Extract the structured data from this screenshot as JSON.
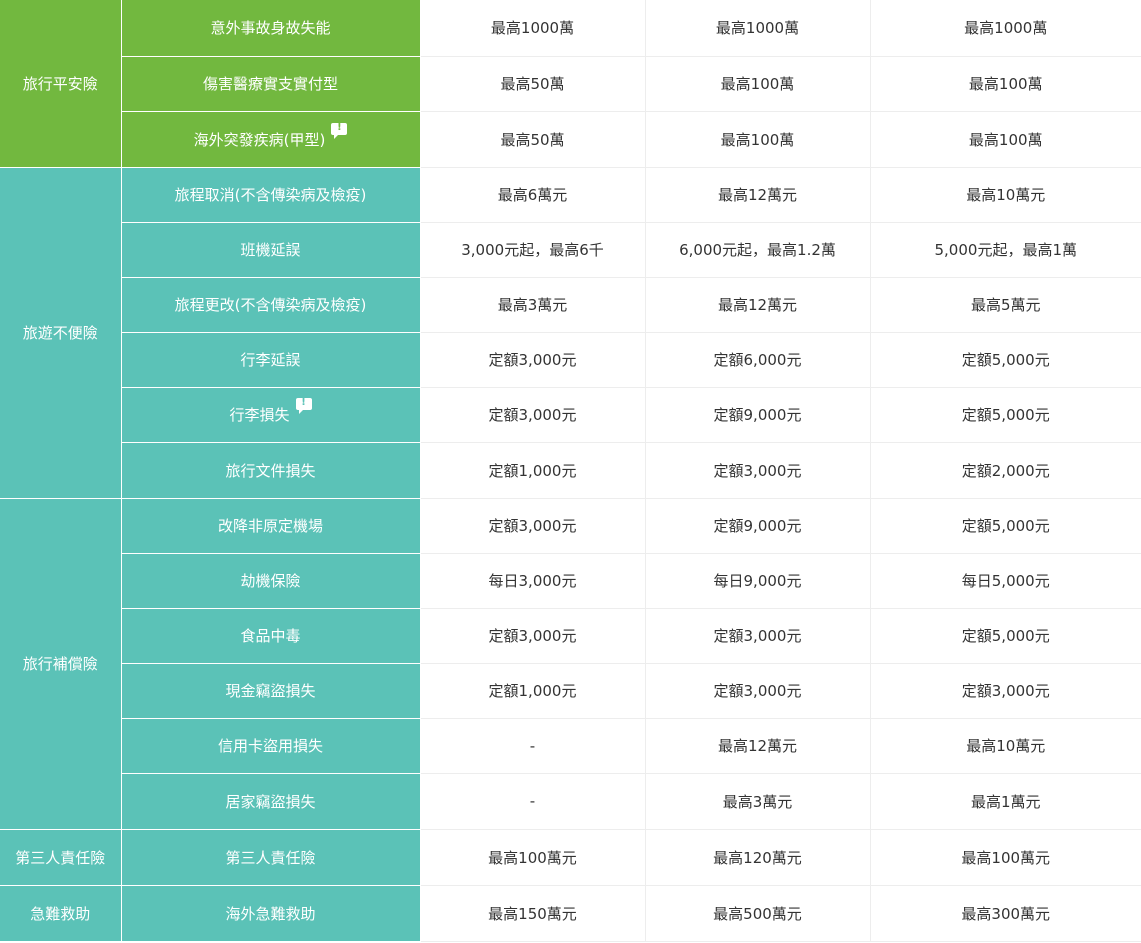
{
  "rows": [
    {
      "category": "旅行平安險",
      "item": "意外事故身故失能",
      "note": false,
      "values": [
        "最高1000萬",
        "最高1000萬",
        "最高1000萬"
      ]
    },
    {
      "item": "傷害醫療實支實付型",
      "note": false,
      "values": [
        "最高50萬",
        "最高100萬",
        "最高100萬"
      ]
    },
    {
      "item": "海外突發疾病(甲型)",
      "note": true,
      "values": [
        "最高50萬",
        "最高100萬",
        "最高100萬"
      ]
    },
    {
      "category": "旅遊不便險",
      "item": "旅程取消(不含傳染病及檢疫)",
      "note": false,
      "values": [
        "最高6萬元",
        "最高12萬元",
        "最高10萬元"
      ]
    },
    {
      "item": "班機延誤",
      "note": false,
      "values": [
        "3,000元起，最高6千",
        "6,000元起，最高1.2萬",
        "5,000元起，最高1萬"
      ]
    },
    {
      "item": "旅程更改(不含傳染病及檢疫)",
      "note": false,
      "values": [
        "最高3萬元",
        "最高12萬元",
        "最高5萬元"
      ]
    },
    {
      "item": "行李延誤",
      "note": false,
      "values": [
        "定額3,000元",
        "定額6,000元",
        "定額5,000元"
      ]
    },
    {
      "item": "行李損失",
      "note": true,
      "values": [
        "定額3,000元",
        "定額9,000元",
        "定額5,000元"
      ]
    },
    {
      "item": "旅行文件損失",
      "note": false,
      "values": [
        "定額1,000元",
        "定額3,000元",
        "定額2,000元"
      ]
    },
    {
      "category": "旅行補償險",
      "item": "改降非原定機場",
      "note": false,
      "values": [
        "定額3,000元",
        "定額9,000元",
        "定額5,000元"
      ]
    },
    {
      "item": "劫機保險",
      "note": false,
      "values": [
        "每日3,000元",
        "每日9,000元",
        "每日5,000元"
      ]
    },
    {
      "item": "食品中毒",
      "note": false,
      "values": [
        "定額3,000元",
        "定額3,000元",
        "定額5,000元"
      ]
    },
    {
      "item": "現金竊盜損失",
      "note": false,
      "values": [
        "定額1,000元",
        "定額3,000元",
        "定額3,000元"
      ]
    },
    {
      "item": "信用卡盜用損失",
      "note": false,
      "values": [
        "-",
        "最高12萬元",
        "最高10萬元"
      ]
    },
    {
      "item": "居家竊盜損失",
      "note": false,
      "values": [
        "-",
        "最高3萬元",
        "最高1萬元"
      ]
    },
    {
      "category": "第三人責任險",
      "item": "第三人責任險",
      "note": false,
      "values": [
        "最高100萬元",
        "最高120萬元",
        "最高100萬元"
      ]
    },
    {
      "category": "急難救助",
      "item": "海外急難救助",
      "note": false,
      "values": [
        "最高150萬元",
        "最高500萬元",
        "最高300萬元"
      ]
    }
  ]
}
